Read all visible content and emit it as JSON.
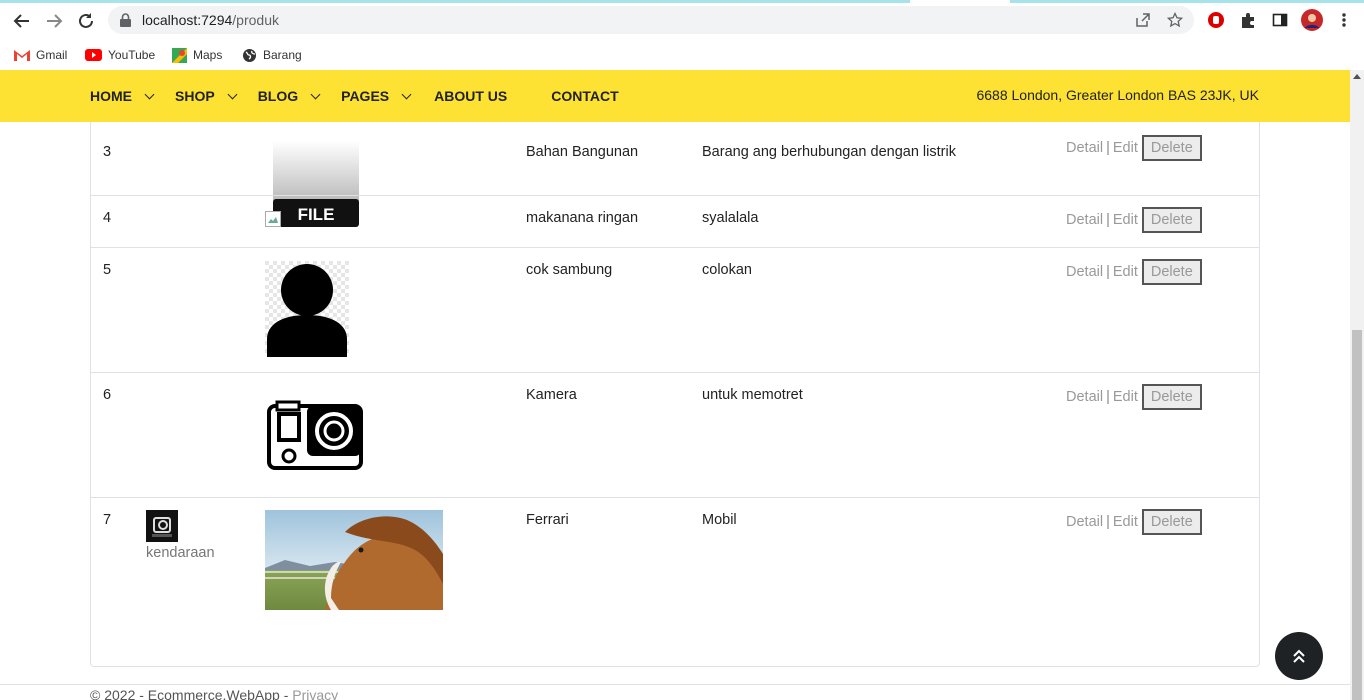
{
  "browser": {
    "url_host": "localhost:7294",
    "url_path": "/produk",
    "bookmarks": [
      {
        "label": "Gmail"
      },
      {
        "label": "YouTube"
      },
      {
        "label": "Maps"
      },
      {
        "label": "Barang"
      }
    ]
  },
  "navbar": {
    "menu": [
      {
        "label": "HOME",
        "dropdown": true
      },
      {
        "label": "SHOP",
        "dropdown": true
      },
      {
        "label": "BLOG",
        "dropdown": true
      },
      {
        "label": "PAGES",
        "dropdown": true
      },
      {
        "label": "ABOUT US",
        "dropdown": false
      },
      {
        "label": "CONTACT",
        "dropdown": false
      }
    ],
    "address": "6688 London, Greater London BAS 23JK, UK"
  },
  "table": {
    "action_labels": {
      "detail": "Detail",
      "edit": "Edit",
      "delete": "Delete",
      "separator": "|"
    },
    "rows": [
      {
        "id": "3",
        "category": "",
        "image": "file-icon",
        "name": "Bahan Bangunan",
        "description": "Barang ang berhubungan dengan listrik"
      },
      {
        "id": "4",
        "category": "",
        "image": "broken-image",
        "name": "makanana ringan",
        "description": "syalalala"
      },
      {
        "id": "5",
        "category": "",
        "image": "person-silhouette",
        "name": "cok sambung",
        "description": "colokan"
      },
      {
        "id": "6",
        "category": "",
        "image": "action-camera",
        "name": "Kamera",
        "description": "untuk memotret"
      },
      {
        "id": "7",
        "category": "kendaraan",
        "image": "horse-photo",
        "name": "Ferrari",
        "description": "Mobil"
      }
    ]
  },
  "footer": {
    "copyright": "© 2022 - Ecommerce.WebApp -",
    "privacy": "Privacy"
  },
  "colors": {
    "navbar": "#fde233",
    "to_top": "#1f2224"
  }
}
